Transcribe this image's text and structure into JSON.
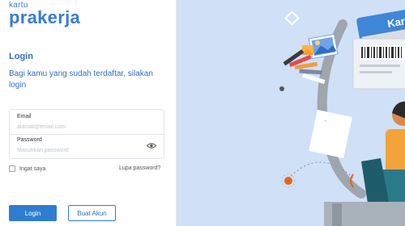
{
  "brand": {
    "top": "kartu",
    "main": "prakerja"
  },
  "login": {
    "title": "Login",
    "subtitle": "Bagi kamu yang sudah terdaftar, silakan login",
    "email_label": "Email",
    "email_placeholder": "alamat@email.com",
    "password_label": "Password",
    "password_placeholder": "Masukkan password",
    "remember_label": "Ingat saya",
    "forgot_label": "Lupa password?",
    "login_button": "Login",
    "create_button": "Buat Akun"
  },
  "illustration": {
    "card_text": "Kar"
  },
  "colors": {
    "accent": "#2f7dd1",
    "brand_orange": "#f39c3c",
    "panel_bg": "#cfe0f7"
  }
}
